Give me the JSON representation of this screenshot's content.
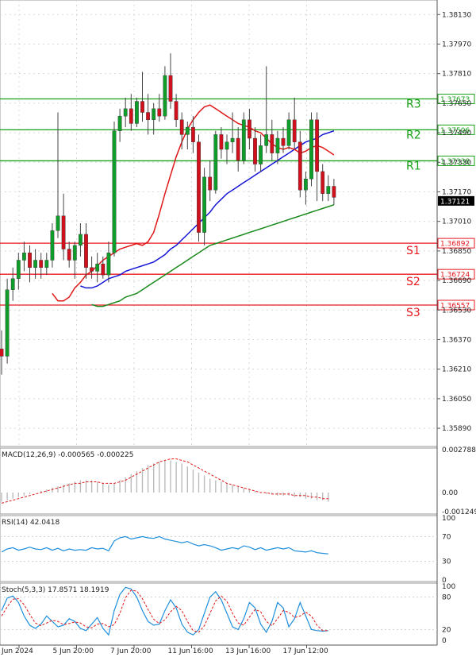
{
  "chart_data": {
    "type": "candlestick",
    "main": {
      "ylim": [
        1.358,
        1.382
      ],
      "price_ticks": [
        "1.38130",
        "1.37970",
        "1.37810",
        "1.37650",
        "1.37490",
        "1.37330",
        "1.37170",
        "1.37010",
        "1.36850",
        "1.36690",
        "1.36530",
        "1.36370",
        "1.36210",
        "1.36050",
        "1.35890"
      ],
      "current_price": "1.37121",
      "levels": [
        {
          "name": "R3",
          "value": 1.37673,
          "label": "1.37673",
          "kind": "resistance"
        },
        {
          "name": "R2",
          "value": 1.37506,
          "label": "1.37506",
          "kind": "resistance"
        },
        {
          "name": "R1",
          "value": 1.37338,
          "label": "1.37338",
          "kind": "resistance"
        },
        {
          "name": "S1",
          "value": 1.36892,
          "label": "1.36892",
          "kind": "support"
        },
        {
          "name": "S2",
          "value": 1.36724,
          "label": "1.36724",
          "kind": "support"
        },
        {
          "name": "S3",
          "value": 1.36557,
          "label": "1.36557",
          "kind": "support"
        }
      ],
      "candles": [
        [
          1.3632,
          1.3642,
          1.3618,
          1.3628
        ],
        [
          1.3628,
          1.367,
          1.3624,
          1.3664
        ],
        [
          1.3664,
          1.3676,
          1.3658,
          1.367
        ],
        [
          1.367,
          1.3684,
          1.3664,
          1.368
        ],
        [
          1.368,
          1.369,
          1.3674,
          1.3684
        ],
        [
          1.3684,
          1.3688,
          1.3668,
          1.3676
        ],
        [
          1.3676,
          1.3686,
          1.367,
          1.368
        ],
        [
          1.368,
          1.3684,
          1.367,
          1.3676
        ],
        [
          1.3676,
          1.3684,
          1.3672,
          1.368
        ],
        [
          1.368,
          1.37,
          1.3676,
          1.3696
        ],
        [
          1.3696,
          1.376,
          1.3692,
          1.3704
        ],
        [
          1.3704,
          1.3716,
          1.368,
          1.3686
        ],
        [
          1.3686,
          1.369,
          1.3676,
          1.368
        ],
        [
          1.368,
          1.369,
          1.367,
          1.3688
        ],
        [
          1.3688,
          1.37,
          1.3682,
          1.3694
        ],
        [
          1.3694,
          1.37,
          1.367,
          1.3676
        ],
        [
          1.3676,
          1.3682,
          1.367,
          1.3674
        ],
        [
          1.3674,
          1.3684,
          1.3668,
          1.3678
        ],
        [
          1.3678,
          1.3682,
          1.367,
          1.3672
        ],
        [
          1.3672,
          1.369,
          1.3668,
          1.3684
        ],
        [
          1.3684,
          1.3755,
          1.3682,
          1.375
        ],
        [
          1.375,
          1.3762,
          1.3744,
          1.3758
        ],
        [
          1.3758,
          1.3768,
          1.3752,
          1.3762
        ],
        [
          1.3762,
          1.377,
          1.375,
          1.3754
        ],
        [
          1.3754,
          1.3768,
          1.3752,
          1.3766
        ],
        [
          1.3766,
          1.3782,
          1.3755,
          1.376
        ],
        [
          1.376,
          1.377,
          1.3748,
          1.3756
        ],
        [
          1.3756,
          1.3765,
          1.3748,
          1.3762
        ],
        [
          1.3762,
          1.377,
          1.3755,
          1.3758
        ],
        [
          1.3758,
          1.3785,
          1.3756,
          1.378
        ],
        [
          1.378,
          1.3792,
          1.3762,
          1.3766
        ],
        [
          1.3766,
          1.377,
          1.3752,
          1.3756
        ],
        [
          1.3756,
          1.376,
          1.374,
          1.3748
        ],
        [
          1.3748,
          1.3755,
          1.374,
          1.3752
        ],
        [
          1.3752,
          1.3758,
          1.3738,
          1.3744
        ],
        [
          1.3744,
          1.3748,
          1.369,
          1.3695
        ],
        [
          1.3695,
          1.373,
          1.3688,
          1.3725
        ],
        [
          1.3725,
          1.3734,
          1.3712,
          1.3718
        ],
        [
          1.3718,
          1.375,
          1.3716,
          1.3748
        ],
        [
          1.3748,
          1.3752,
          1.3735,
          1.374
        ],
        [
          1.374,
          1.3748,
          1.3732,
          1.3744
        ],
        [
          1.3744,
          1.376,
          1.3738,
          1.3746
        ],
        [
          1.3746,
          1.3752,
          1.3728,
          1.3734
        ],
        [
          1.3734,
          1.376,
          1.3732,
          1.3756
        ],
        [
          1.3756,
          1.3762,
          1.374,
          1.3746
        ],
        [
          1.3746,
          1.3752,
          1.3728,
          1.3732
        ],
        [
          1.3732,
          1.3748,
          1.3728,
          1.3742
        ],
        [
          1.3742,
          1.3785,
          1.3738,
          1.3748
        ],
        [
          1.3748,
          1.3756,
          1.3734,
          1.3738
        ],
        [
          1.3738,
          1.375,
          1.3732,
          1.3746
        ],
        [
          1.3746,
          1.3752,
          1.3738,
          1.3742
        ],
        [
          1.3742,
          1.376,
          1.374,
          1.3756
        ],
        [
          1.3756,
          1.3768,
          1.374,
          1.3744
        ],
        [
          1.3744,
          1.375,
          1.3714,
          1.3718
        ],
        [
          1.3718,
          1.3728,
          1.371,
          1.3724
        ],
        [
          1.3724,
          1.376,
          1.372,
          1.3756
        ],
        [
          1.3756,
          1.376,
          1.3712,
          1.3728
        ],
        [
          1.3728,
          1.3732,
          1.3712,
          1.3716
        ],
        [
          1.3716,
          1.3726,
          1.3712,
          1.372
        ],
        [
          1.372,
          1.3724,
          1.371,
          1.3714
        ]
      ],
      "sma_fast": [
        1.3662,
        1.3658,
        1.3658,
        1.366,
        1.3665,
        1.3668,
        1.3672,
        1.3674,
        1.3677,
        1.368,
        1.3682,
        1.3684,
        1.3686,
        1.3687,
        1.3688,
        1.3689,
        1.3688,
        1.369,
        1.3695,
        1.3705,
        1.3716,
        1.3726,
        1.3736,
        1.3744,
        1.3751,
        1.3756,
        1.376,
        1.3763,
        1.3764,
        1.3762,
        1.376,
        1.3758,
        1.3756,
        1.3754,
        1.3753,
        1.3752,
        1.375,
        1.3749,
        1.3746,
        1.3743,
        1.3741,
        1.374,
        1.3741,
        1.374,
        1.3738,
        1.3739,
        1.3741,
        1.3742,
        1.3741,
        1.3739,
        1.3737
      ],
      "sma_mid": [
        1.3666,
        1.3665,
        1.3665,
        1.3666,
        1.3668,
        1.367,
        1.3671,
        1.3672,
        1.3674,
        1.3675,
        1.3676,
        1.3677,
        1.3678,
        1.3679,
        1.3681,
        1.3683,
        1.3686,
        1.3688,
        1.3691,
        1.3694,
        1.3697,
        1.37,
        1.3703,
        1.3706,
        1.371,
        1.3713,
        1.3716,
        1.3718,
        1.372,
        1.3722,
        1.3724,
        1.3726,
        1.3728,
        1.373,
        1.3732,
        1.3734,
        1.3736,
        1.3738,
        1.374,
        1.3742,
        1.3744,
        1.3745,
        1.3746,
        1.3748,
        1.3749,
        1.375
      ],
      "sma_slow": [
        1.3656,
        1.3655,
        1.3655,
        1.3656,
        1.3657,
        1.3658,
        1.366,
        1.3661,
        1.3662,
        1.3664,
        1.3666,
        1.3668,
        1.367,
        1.3672,
        1.3674,
        1.3676,
        1.3678,
        1.368,
        1.3682,
        1.3684,
        1.3686,
        1.3688,
        1.3689,
        1.369,
        1.3691,
        1.3692,
        1.3693,
        1.3694,
        1.3695,
        1.3696,
        1.3697,
        1.3698,
        1.3699,
        1.37,
        1.3701,
        1.3702,
        1.3703,
        1.3704,
        1.3705,
        1.3706,
        1.3707,
        1.3708,
        1.3709,
        1.371
      ]
    },
    "x_labels": [
      "Jun 2024",
      "5 Jun 20:00",
      "7 Jun 20:00",
      "11 Jun 16:00",
      "13 Jun 16:00",
      "17 Jun 12:00"
    ],
    "macd": {
      "label": "MACD(12,26,9) -0.000565 -0.000225",
      "ticks": [
        "0.002788",
        "0.00",
        "-0.001249"
      ],
      "ylim": [
        -0.0013,
        0.0028
      ],
      "hist": [
        -0.0006,
        -0.0005,
        -0.0004,
        -0.0003,
        -0.0002,
        -0.0001,
        0.0,
        0.0001,
        0.0002,
        0.0003,
        0.0004,
        0.0005,
        0.0006,
        0.0007,
        0.0008,
        0.0008,
        0.0008,
        0.0007,
        0.0006,
        0.0005,
        0.0006,
        0.0008,
        0.001,
        0.0012,
        0.0014,
        0.0016,
        0.0018,
        0.0019,
        0.002,
        0.0021,
        0.0021,
        0.002,
        0.0019,
        0.0017,
        0.0015,
        0.0013,
        0.0011,
        0.0009,
        0.0008,
        0.0007,
        0.0006,
        0.0005,
        0.0004,
        0.0003,
        0.0002,
        0.0001,
        0.0,
        -0.0001,
        -0.0001,
        -0.0002,
        -0.0002,
        -0.0002,
        -0.0003,
        -0.0003,
        -0.0004,
        -0.0004,
        -0.0005,
        -0.0005,
        -0.0006
      ],
      "signal": [
        -0.0007,
        -0.0006,
        -0.0005,
        -0.0004,
        -0.0003,
        -0.0002,
        -0.0001,
        0.0,
        0.0001,
        0.0002,
        0.0003,
        0.0004,
        0.0005,
        0.0006,
        0.0006,
        0.0007,
        0.0007,
        0.0007,
        0.0006,
        0.0006,
        0.0006,
        0.0007,
        0.0008,
        0.001,
        0.0012,
        0.0014,
        0.0016,
        0.0018,
        0.002,
        0.0021,
        0.0022,
        0.0022,
        0.0021,
        0.002,
        0.0018,
        0.0016,
        0.0014,
        0.0012,
        0.001,
        0.0008,
        0.0006,
        0.0005,
        0.0004,
        0.0003,
        0.0002,
        0.0001,
        0.0,
        0.0,
        -0.0001,
        -0.0001,
        -0.0001,
        -0.0001,
        -0.0002,
        -0.0002,
        -0.0002,
        -0.0003,
        -0.0003,
        -0.0004,
        -0.0004
      ]
    },
    "rsi": {
      "label": "RSI(14) 42.0418",
      "ticks": [
        "100",
        "70",
        "30",
        "0"
      ],
      "values": [
        45,
        50,
        52,
        48,
        50,
        53,
        50,
        49,
        52,
        48,
        51,
        47,
        50,
        48,
        49,
        48,
        52,
        50,
        51,
        47,
        63,
        68,
        70,
        66,
        68,
        70,
        68,
        67,
        70,
        66,
        64,
        62,
        60,
        62,
        58,
        55,
        57,
        55,
        52,
        48,
        50,
        52,
        50,
        55,
        53,
        49,
        52,
        48,
        50,
        52,
        50,
        52,
        47,
        46,
        45,
        47,
        44,
        43,
        42
      ]
    },
    "stoch": {
      "label": "Stoch(5,3,3) 17.8571 18.1919",
      "ticks": [
        "100",
        "80",
        "20",
        "0"
      ],
      "k": [
        55,
        78,
        82,
        70,
        45,
        28,
        22,
        30,
        45,
        35,
        25,
        28,
        40,
        35,
        22,
        18,
        30,
        42,
        22,
        10,
        55,
        85,
        98,
        95,
        80,
        55,
        35,
        28,
        30,
        55,
        75,
        60,
        30,
        15,
        10,
        20,
        50,
        80,
        90,
        75,
        50,
        25,
        20,
        40,
        70,
        60,
        30,
        15,
        35,
        70,
        60,
        25,
        40,
        70,
        45,
        20,
        18,
        17,
        18
      ],
      "d": [
        45,
        62,
        76,
        77,
        66,
        48,
        32,
        27,
        32,
        37,
        35,
        29,
        31,
        34,
        32,
        25,
        23,
        30,
        31,
        25,
        29,
        50,
        79,
        93,
        91,
        77,
        57,
        39,
        31,
        38,
        53,
        63,
        55,
        35,
        18,
        15,
        27,
        50,
        73,
        82,
        72,
        50,
        32,
        28,
        43,
        57,
        53,
        35,
        27,
        40,
        55,
        52,
        42,
        45,
        52,
        45,
        28,
        18,
        18
      ]
    }
  }
}
